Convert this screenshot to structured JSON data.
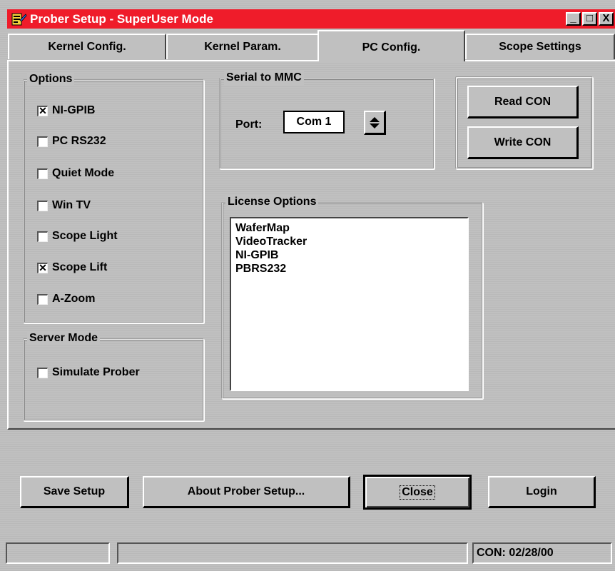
{
  "window": {
    "title": "Prober Setup - SuperUser Mode",
    "minimize": "_",
    "maximize": "□",
    "close": "X"
  },
  "tabs": [
    {
      "label": "Kernel Config."
    },
    {
      "label": "Kernel Param."
    },
    {
      "label": "PC Config.",
      "active": true
    },
    {
      "label": "Scope Settings"
    }
  ],
  "options": {
    "legend": "Options",
    "items": [
      {
        "label": "NI-GPIB",
        "checked": true
      },
      {
        "label": "PC RS232",
        "checked": false
      },
      {
        "label": "Quiet Mode",
        "checked": false
      },
      {
        "label": "Win TV",
        "checked": false
      },
      {
        "label": "Scope Light",
        "checked": false
      },
      {
        "label": "Scope Lift",
        "checked": true
      },
      {
        "label": "A-Zoom",
        "checked": false
      }
    ]
  },
  "server_mode": {
    "legend": "Server Mode",
    "simulate_label": "Simulate Prober",
    "simulate_checked": false
  },
  "serial": {
    "legend": "Serial to MMC",
    "port_label": "Port:",
    "port_value": "Com 1"
  },
  "con_buttons": {
    "read": "Read CON",
    "write": "Write CON"
  },
  "license": {
    "legend": "License Options",
    "items": [
      "WaferMap",
      "VideoTracker",
      "NI-GPIB",
      "PBRS232"
    ]
  },
  "footer": {
    "save": "Save Setup",
    "about": "About Prober Setup...",
    "close": "Close",
    "login": "Login"
  },
  "statusbar": {
    "pane1": "",
    "pane2": "",
    "con_date": "CON: 02/28/00"
  },
  "colors": {
    "titlebar": "#ef1c2a",
    "face": "#c0c0c0"
  }
}
